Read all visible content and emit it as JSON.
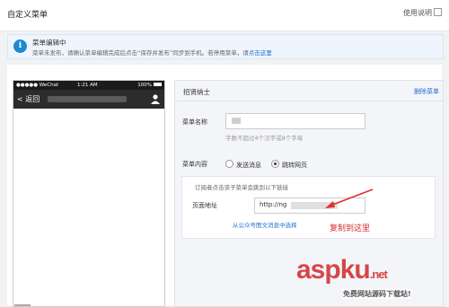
{
  "header": {
    "title": "自定义菜单",
    "help_label": "使用说明"
  },
  "notice": {
    "title": "菜单编辑中",
    "message": "菜单未发布，请确认菜单编辑完成后点击“保存并发布”同步到手机。若停用菜单，请",
    "link": "点击这里"
  },
  "phone": {
    "carrier": "●●●●● WeChat",
    "time": "1:21 AM",
    "battery": "100%",
    "back_label": "返回"
  },
  "editor": {
    "menu_name": "招贤纳士",
    "delete_label": "删除菜单",
    "name_label": "菜单名称",
    "name_hint": "字数不超过4个汉字或8个字母",
    "content_label": "菜单内容",
    "option_message": "发送消息",
    "option_webpage": "跳转网页",
    "selected_option": "option_webpage",
    "desc": "订阅者点击该子菜单会跳到以下链接",
    "page_url_label": "页面地址",
    "page_url_value": "http://ng",
    "choose_link": "从公众号图文消息中选择"
  },
  "annotation": {
    "note": "复制到这里",
    "color": "#d62c2c"
  },
  "watermark": {
    "brand": "aspku",
    "brand_suffix": ".net",
    "sub": "免费网站源码下载站!"
  }
}
